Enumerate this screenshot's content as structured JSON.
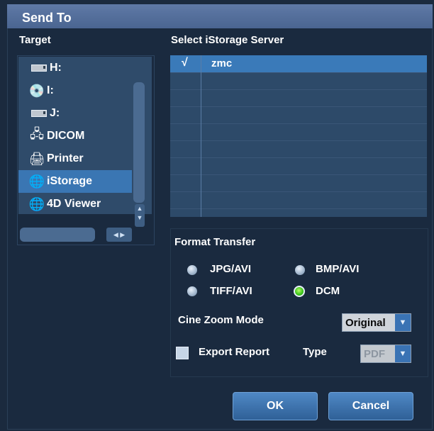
{
  "dialog": {
    "title": "Send To"
  },
  "target": {
    "label": "Target",
    "items": [
      {
        "label": "H:",
        "icon": "usb-drive-icon",
        "selected": false
      },
      {
        "label": "I:",
        "icon": "dvd-drive-icon",
        "selected": false
      },
      {
        "label": "J:",
        "icon": "usb-drive-icon",
        "selected": false
      },
      {
        "label": "DICOM",
        "icon": "dicom-network-icon",
        "selected": false
      },
      {
        "label": "Printer",
        "icon": "printer-icon",
        "selected": false
      },
      {
        "label": "iStorage",
        "icon": "istorage-icon",
        "selected": true
      },
      {
        "label": "4D Viewer",
        "icon": "4d-viewer-icon",
        "selected": false
      }
    ]
  },
  "server": {
    "label": "Select iStorage Server",
    "rows": [
      {
        "check": "√",
        "name": "zmc"
      }
    ]
  },
  "format": {
    "label": "Format Transfer",
    "options": [
      {
        "label": "JPG/AVI",
        "selected": false
      },
      {
        "label": "BMP/AVI",
        "selected": false
      },
      {
        "label": "TIFF/AVI",
        "selected": false
      },
      {
        "label": "DCM",
        "selected": true
      }
    ],
    "cine_label": "Cine Zoom Mode",
    "cine_value": "Original",
    "export_label": "Export Report",
    "type_label": "Type",
    "type_value": "PDF"
  },
  "buttons": {
    "ok": "OK",
    "cancel": "Cancel"
  },
  "colors": {
    "selection": "#3a76b3",
    "radio_on": "#3fc61d",
    "title_bar": "#4a6591"
  }
}
